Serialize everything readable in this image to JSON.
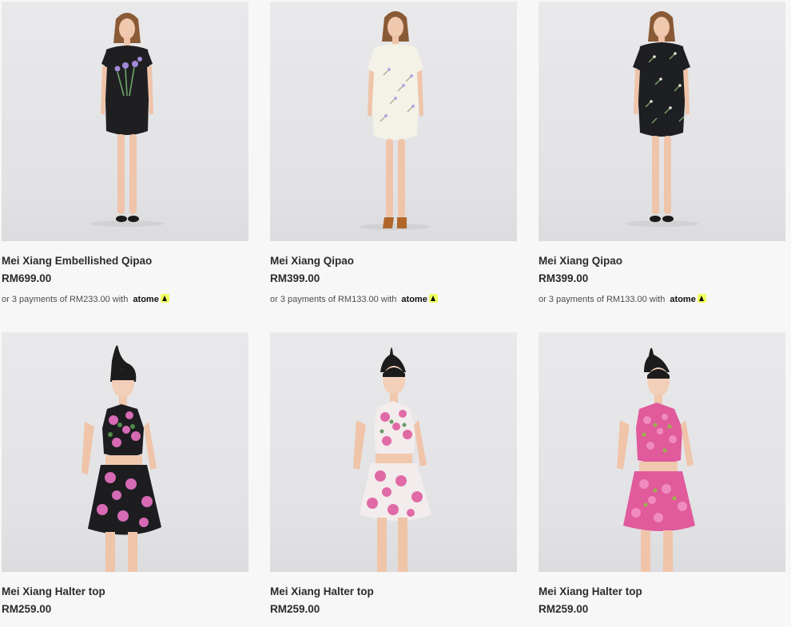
{
  "products": [
    {
      "title": "Mei Xiang Embellished Qipao",
      "price": "RM699.00",
      "installment_text": "or 3 payments of RM233.00 with",
      "provider": "atome",
      "image": "black-qipao-with-iris-embroidery"
    },
    {
      "title": "Mei Xiang Qipao",
      "price": "RM399.00",
      "installment_text": "or 3 payments of RM133.00 with",
      "provider": "atome",
      "image": "white-qipao-with-floral-print"
    },
    {
      "title": "Mei Xiang Qipao",
      "price": "RM399.00",
      "installment_text": "or 3 payments of RM133.00 with",
      "provider": "atome",
      "image": "black-qipao-with-floral-print"
    },
    {
      "title": "Mei Xiang Halter top",
      "price": "RM259.00",
      "image": "black-pink-floral-halter-set"
    },
    {
      "title": "Mei Xiang Halter top",
      "price": "RM259.00",
      "image": "white-pink-floral-halter-set"
    },
    {
      "title": "Mei Xiang Halter top",
      "price": "RM259.00",
      "image": "pink-floral-halter-set"
    }
  ],
  "colors": {
    "background": "#f7f7f7",
    "photo_backdrop": "#e6e6e8",
    "text": "#2b2b2b",
    "atome_badge": "#f0ff5f"
  }
}
